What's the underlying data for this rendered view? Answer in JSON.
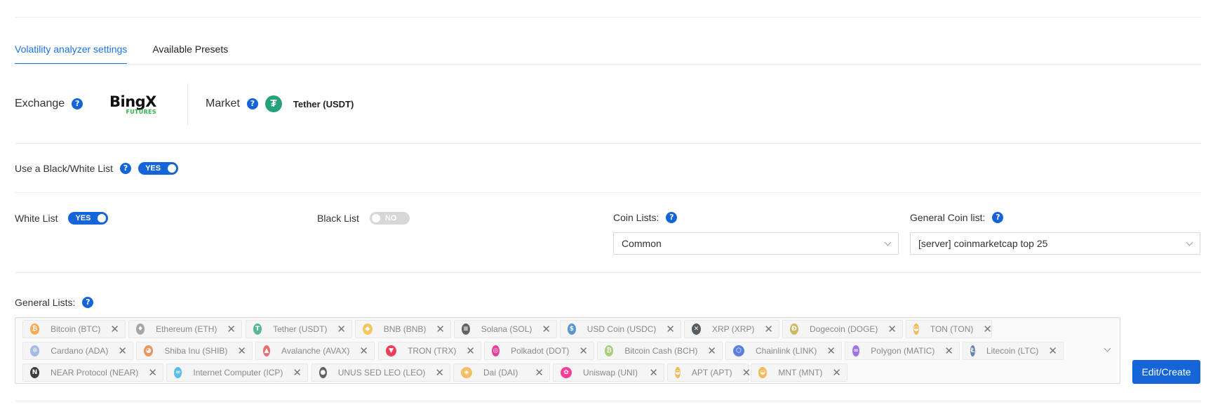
{
  "tabs": [
    {
      "label": "Volatility analyzer settings",
      "active": true
    },
    {
      "label": "Available Presets",
      "active": false
    }
  ],
  "exchange": {
    "label": "Exchange",
    "logo_text": "BingX",
    "logo_sub": "FUTURES"
  },
  "market": {
    "label": "Market",
    "value": "Tether (USDT)"
  },
  "bwlist": {
    "label": "Use a Black/White List",
    "toggle": "YES"
  },
  "whitelist": {
    "label": "White List",
    "toggle": "YES"
  },
  "blacklist": {
    "label": "Black List",
    "toggle": "NO"
  },
  "coin_lists": {
    "label": "Coin Lists:",
    "value": "Common"
  },
  "general_coin_list": {
    "label": "General Coin list:",
    "value": "[server] coinmarketcap top 25"
  },
  "general_lists": {
    "label": "General Lists:",
    "tags": [
      {
        "label": "Bitcoin (BTC)",
        "color": "#f7931a",
        "glyph": "₿"
      },
      {
        "label": "Ethereum (ETH)",
        "color": "#8c8c8c",
        "glyph": "♦"
      },
      {
        "label": "Tether (USDT)",
        "color": "#26a17b",
        "glyph": "T"
      },
      {
        "label": "BNB (BNB)",
        "color": "#f3ba2f",
        "glyph": "◆"
      },
      {
        "label": "Solana (SOL)",
        "color": "#333333",
        "glyph": "≡"
      },
      {
        "label": "USD Coin (USDC)",
        "color": "#2775ca",
        "glyph": "$"
      },
      {
        "label": "XRP (XRP)",
        "color": "#23292f",
        "glyph": "✕"
      },
      {
        "label": "Dogecoin (DOGE)",
        "color": "#c2a633",
        "glyph": "Ð"
      },
      {
        "label": "TON (TON)",
        "color": "#f5a623",
        "glyph": "◒"
      },
      {
        "label": "Cardano (ADA)",
        "color": "#8aa8e6",
        "glyph": "✲"
      },
      {
        "label": "Shiba Inu (SHIB)",
        "color": "#e57a2d",
        "glyph": "◕"
      },
      {
        "label": "Avalanche (AVAX)",
        "color": "#e84142",
        "glyph": "▲"
      },
      {
        "label": "TRON (TRX)",
        "color": "#eb0029",
        "glyph": "▼"
      },
      {
        "label": "Polkadot (DOT)",
        "color": "#e6007a",
        "glyph": "◎"
      },
      {
        "label": "Bitcoin Cash (BCH)",
        "color": "#8dc351",
        "glyph": "₿"
      },
      {
        "label": "Chainlink (LINK)",
        "color": "#2a5ada",
        "glyph": "⬡"
      },
      {
        "label": "Polygon (MATIC)",
        "color": "#8247e5",
        "glyph": "∞"
      },
      {
        "label": "Litecoin (LTC)",
        "color": "#345d9d",
        "glyph": "Ł"
      },
      {
        "label": "NEAR Protocol (NEAR)",
        "color": "#000000",
        "glyph": "N"
      },
      {
        "label": "Internet Computer (ICP)",
        "color": "#29abe2",
        "glyph": "∞"
      },
      {
        "label": "UNUS SED LEO (LEO)",
        "color": "#333333",
        "glyph": "●"
      },
      {
        "label": "Dai (DAI)",
        "color": "#f5ac37",
        "glyph": "◈"
      },
      {
        "label": "Uniswap (UNI)",
        "color": "#ff007a",
        "glyph": "✿"
      },
      {
        "label": "APT (APT)",
        "color": "#f5a623",
        "glyph": "◒"
      },
      {
        "label": "MNT (MNT)",
        "color": "#f5a623",
        "glyph": "◒"
      }
    ]
  },
  "edit_button": "Edit/Create"
}
